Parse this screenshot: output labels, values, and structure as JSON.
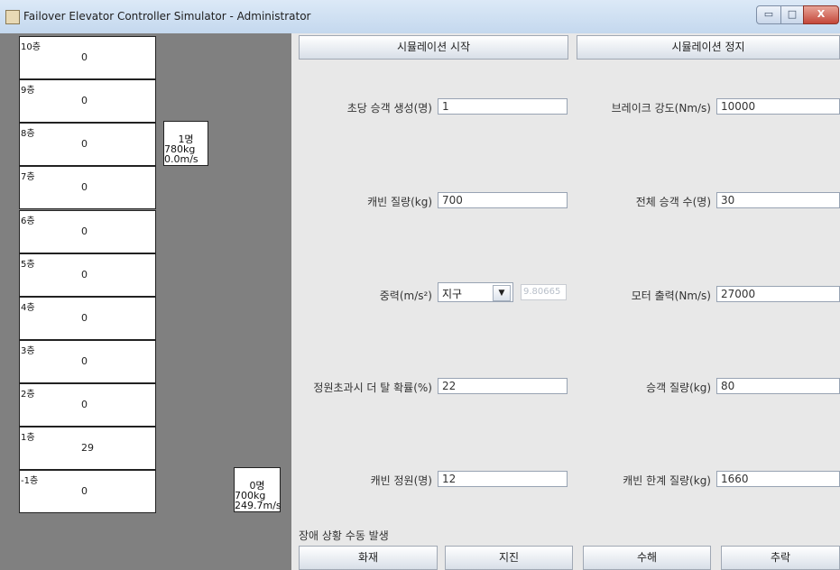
{
  "window": {
    "title": "Failover Elevator Controller Simulator - Administrator",
    "min_glyph": "▭",
    "max_glyph": "□",
    "close_glyph": "X"
  },
  "floors": [
    {
      "label": "10층",
      "count": "0"
    },
    {
      "label": "9층",
      "count": "0"
    },
    {
      "label": "8층",
      "count": "0"
    },
    {
      "label": "7층",
      "count": "0"
    },
    {
      "label": "6층",
      "count": "0"
    },
    {
      "label": "5층",
      "count": "0"
    },
    {
      "label": "4층",
      "count": "0"
    },
    {
      "label": "3층",
      "count": "0"
    },
    {
      "label": "2층",
      "count": "0"
    },
    {
      "label": "1층",
      "count": "29"
    },
    {
      "label": "-1층",
      "count": "0"
    }
  ],
  "cars": [
    {
      "people": "1명",
      "weight": "780kg",
      "speed": "0.0m/s"
    },
    {
      "people": "0명",
      "weight": "700kg",
      "speed": "249.7m/s"
    }
  ],
  "controls": {
    "start_label": "시뮬레이션 시작",
    "stop_label": "시뮬레이션 정지"
  },
  "fields": {
    "pass_rate": {
      "label": "초당 승객 생성(명)",
      "value": "1"
    },
    "brake": {
      "label": "브레이크 강도(Nm/s)",
      "value": "10000"
    },
    "car_mass": {
      "label": "캐빈 질량(kg)",
      "value": "700"
    },
    "total_pass": {
      "label": "전체 승객 수(명)",
      "value": "30"
    },
    "gravity": {
      "label": "중력(m/s²)",
      "selected": "지구",
      "value": "9.80665"
    },
    "motor": {
      "label": "모터 출력(Nm/s)",
      "value": "27000"
    },
    "drop_prob": {
      "label": "정원초과시 더 탈 확률(%)",
      "value": "22"
    },
    "pass_mass": {
      "label": "승객 질량(kg)",
      "value": "80"
    },
    "capacity": {
      "label": "캐빈 정원(명)",
      "value": "12"
    },
    "max_mass": {
      "label": "캐빈 한계 질량(kg)",
      "value": "1660"
    }
  },
  "fault": {
    "heading": "장애 상황 수동 발생",
    "fire": "화재",
    "earthquake": "지진",
    "flood": "수해",
    "fall": "추락"
  }
}
